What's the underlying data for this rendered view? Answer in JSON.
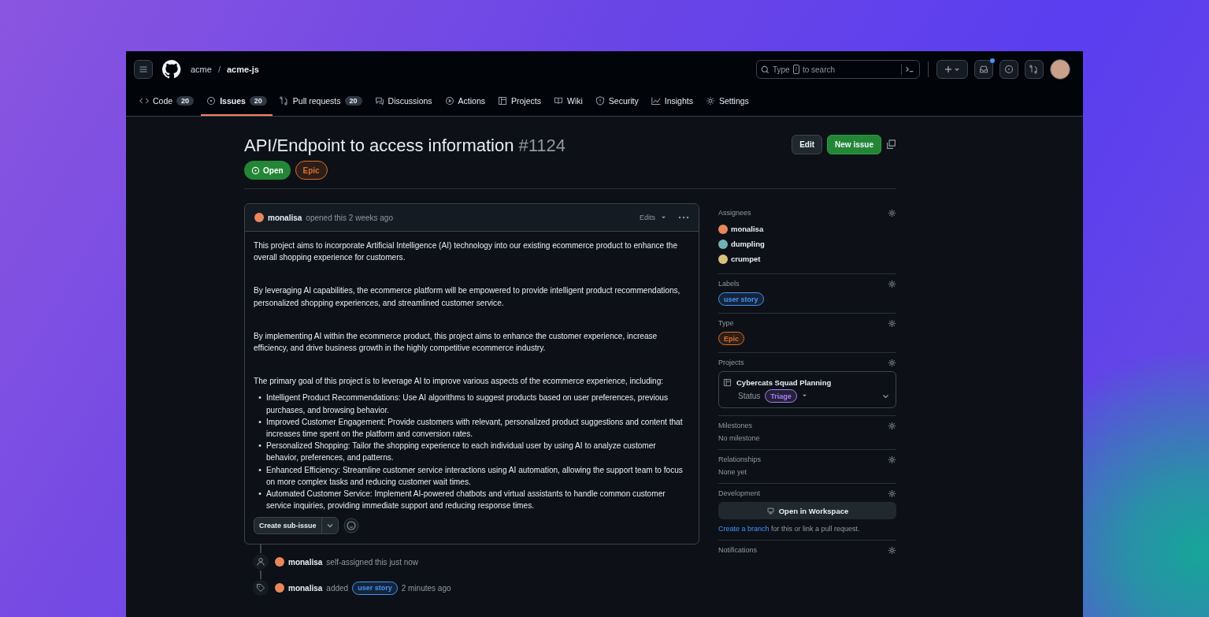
{
  "header": {
    "owner": "acme",
    "separator": "/",
    "repo": "acme-js",
    "search": {
      "prefix": "Type",
      "key": "/",
      "suffix": "to search"
    },
    "inbox_unread": true
  },
  "tabs": [
    {
      "label": "Code",
      "count": "20",
      "selected": false
    },
    {
      "label": "Issues",
      "count": "20",
      "selected": true
    },
    {
      "label": "Pull requests",
      "count": "20",
      "selected": false
    },
    {
      "label": "Discussions",
      "selected": false
    },
    {
      "label": "Actions",
      "selected": false
    },
    {
      "label": "Projects",
      "selected": false
    },
    {
      "label": "Wiki",
      "selected": false
    },
    {
      "label": "Security",
      "selected": false
    },
    {
      "label": "Insights",
      "selected": false
    },
    {
      "label": "Settings",
      "selected": false
    }
  ],
  "issue": {
    "title": "API/Endpoint to access information",
    "number": "#1124",
    "state": "Open",
    "type": {
      "name": "Epic",
      "color": "#db6d28"
    }
  },
  "actions": {
    "edit": "Edit",
    "new_issue": "New issue"
  },
  "comment": {
    "author": "monalisa",
    "action": "opened this 2 weeks ago",
    "edits": "Edits",
    "paragraphs": [
      "This project aims to incorporate Artificial Intelligence (AI) technology into our existing ecommerce product to enhance the overall shopping experience for customers.",
      "By leveraging AI capabilities, the ecommerce platform will be empowered to provide intelligent product recommendations, personalized shopping experiences, and streamlined customer service.",
      "By implementing AI within the ecommerce product, this project aims to enhance the customer experience, increase efficiency, and drive business growth in the highly competitive ecommerce industry.",
      "The primary goal of this project is to leverage AI to improve various aspects of the ecommerce experience, including:"
    ],
    "list_items": [
      "Intelligent Product Recommendations: Use AI algorithms to suggest products based on user preferences, previous purchases, and browsing behavior.",
      "Improved Customer Engagement: Provide customers with relevant, personalized product suggestions and content that increases time spent on the platform and conversion rates.",
      "Personalized Shopping: Tailor the shopping experience to each individual user by using AI to analyze customer behavior, preferences, and patterns.",
      "Enhanced Efficiency: Streamline customer service interactions using AI automation, allowing the support team to focus on more complex tasks and reducing customer wait times.",
      "Automated Customer Service: Implement AI-powered chatbots and virtual assistants to handle common customer service inquiries, providing immediate support and reducing response times."
    ],
    "bullet": "•",
    "create_sub_issue": "Create sub-issue"
  },
  "timeline": [
    {
      "kind": "assigned",
      "actor": "monalisa",
      "text": "self-assigned this just now"
    },
    {
      "kind": "labeled",
      "actor": "monalisa",
      "text": "added",
      "label": {
        "name": "user story",
        "color": "#4493f8"
      },
      "time": "2 minutes ago"
    }
  ],
  "sidebar": [
    {
      "kind": "assignees",
      "heading": "Assignees",
      "users": [
        "monalisa",
        "dumpling",
        "crumpet"
      ]
    },
    {
      "kind": "labels",
      "heading": "Labels",
      "labels": [
        {
          "name": "user story",
          "color": "#4493f8"
        }
      ]
    },
    {
      "kind": "type",
      "heading": "Type",
      "value": {
        "name": "Epic",
        "color": "#db6d28"
      }
    },
    {
      "kind": "projects",
      "heading": "Projects",
      "project": {
        "name": "Cybercats Squad Planning",
        "status_label": "Status",
        "status": {
          "name": "Triage",
          "color": "#ab7df8"
        }
      }
    },
    {
      "kind": "text",
      "heading": "Milestones",
      "text": "No milestone"
    },
    {
      "kind": "text",
      "heading": "Relationships",
      "text": "None yet"
    },
    {
      "kind": "development",
      "heading": "Development",
      "button": "Open in Workspace",
      "link": "Create a branch",
      "rest": "for this or link a pull request."
    },
    {
      "kind": "heading",
      "heading": "Notifications"
    }
  ]
}
